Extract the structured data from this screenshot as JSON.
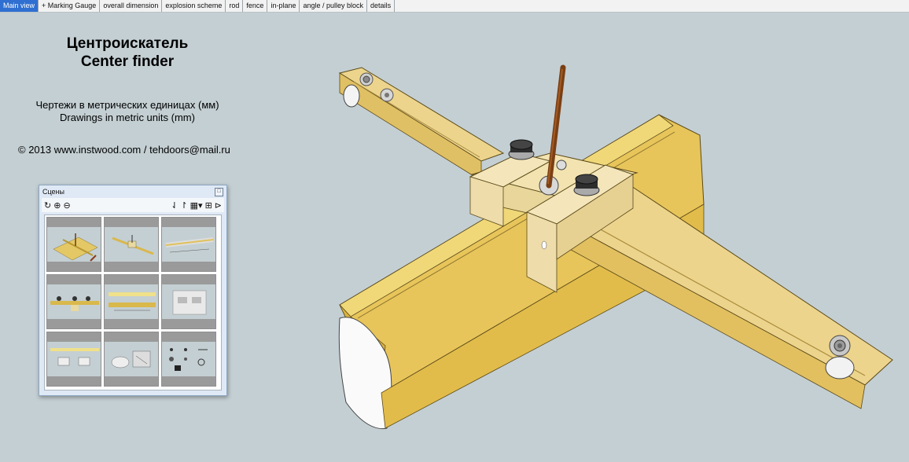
{
  "tabs": [
    {
      "label": "Main view",
      "active": true
    },
    {
      "label": "+ Marking Gauge",
      "active": false
    },
    {
      "label": "overall dimension",
      "active": false
    },
    {
      "label": "explosion scheme",
      "active": false
    },
    {
      "label": "rod",
      "active": false
    },
    {
      "label": "fence",
      "active": false
    },
    {
      "label": "in-plane",
      "active": false
    },
    {
      "label": "angle / pulley block",
      "active": false
    },
    {
      "label": "details",
      "active": false
    }
  ],
  "title": {
    "ru": "Центроискатель",
    "en": "Center finder"
  },
  "subtitle": {
    "ru": "Чертежи в метрических единицах (мм)",
    "en": "Drawings in metric units (mm)"
  },
  "copyright": "© 2013 www.instwood.com / tehdoors@mail.ru",
  "scenes_panel": {
    "title": "Сцены",
    "close_glyph": "□",
    "toolbar_icons": [
      "refresh-icon",
      "add-scene-icon",
      "remove-scene-icon",
      "move-down-icon",
      "move-up-icon",
      "view-options-icon",
      "scene-details-icon",
      "expand-icon"
    ],
    "toolbar_glyphs": {
      "refresh": "↻",
      "add": "⊕",
      "remove": "⊖",
      "down": "⇃",
      "up": "↾",
      "view": "▦▾",
      "details": "⊞",
      "expand": "⊳"
    },
    "thumbnails": 9
  },
  "colors": {
    "background": "#c4cfd3",
    "wood": "#e8cd7d",
    "wood_dark": "#d8b240",
    "active_tab": "#2f6fd1"
  }
}
